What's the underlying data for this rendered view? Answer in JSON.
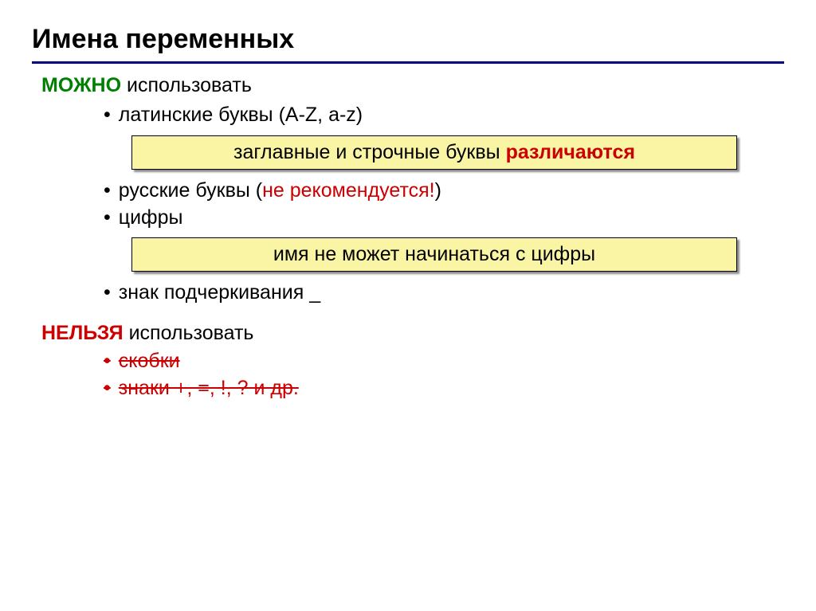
{
  "title": "Имена переменных",
  "allowed": {
    "keyword": "МОЖНО",
    "rest": " использовать",
    "items": {
      "latin": "латинские буквы (A-Z, a-z)",
      "russian_prefix": "русские буквы (",
      "russian_warn": "не рекомендуется!",
      "russian_suffix": ")",
      "digits": "цифры",
      "underscore": "знак подчеркивания _"
    }
  },
  "callouts": {
    "case_prefix": "заглавные и строчные буквы ",
    "case_emph": "различаются",
    "no_digit_start": "имя не может начинаться с цифры"
  },
  "forbidden": {
    "keyword": "НЕЛЬЗЯ",
    "rest": " использовать",
    "items": {
      "brackets": "скобки",
      "signs": "знаки +, =, !, ? и др."
    }
  }
}
